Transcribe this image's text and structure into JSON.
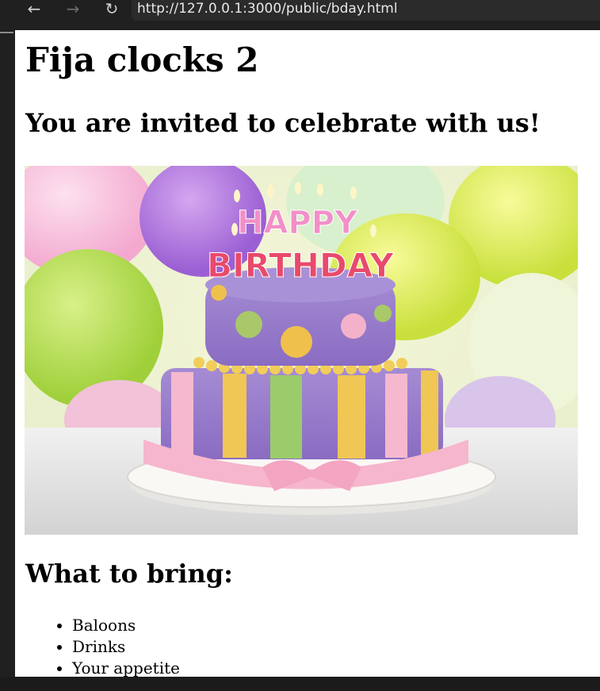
{
  "browser": {
    "back_icon": "arrow-left-icon",
    "forward_icon": "arrow-right-icon",
    "reload_icon": "reload-icon",
    "url": "http://127.0.0.1:3000/public/bday.html"
  },
  "page": {
    "title": "Fija clocks 2",
    "invite_heading": "You are invited to celebrate with us!",
    "image_text": {
      "line1": "HAPPY",
      "line2": "BIRTHDAY"
    },
    "bring_heading": "What to bring:",
    "items": [
      "Baloons",
      "Drinks",
      "Your appetite"
    ]
  },
  "colors": {
    "page_bg": "#ffffff",
    "chrome_bg": "#202020",
    "urlbar_bg": "#2b2b2b"
  }
}
